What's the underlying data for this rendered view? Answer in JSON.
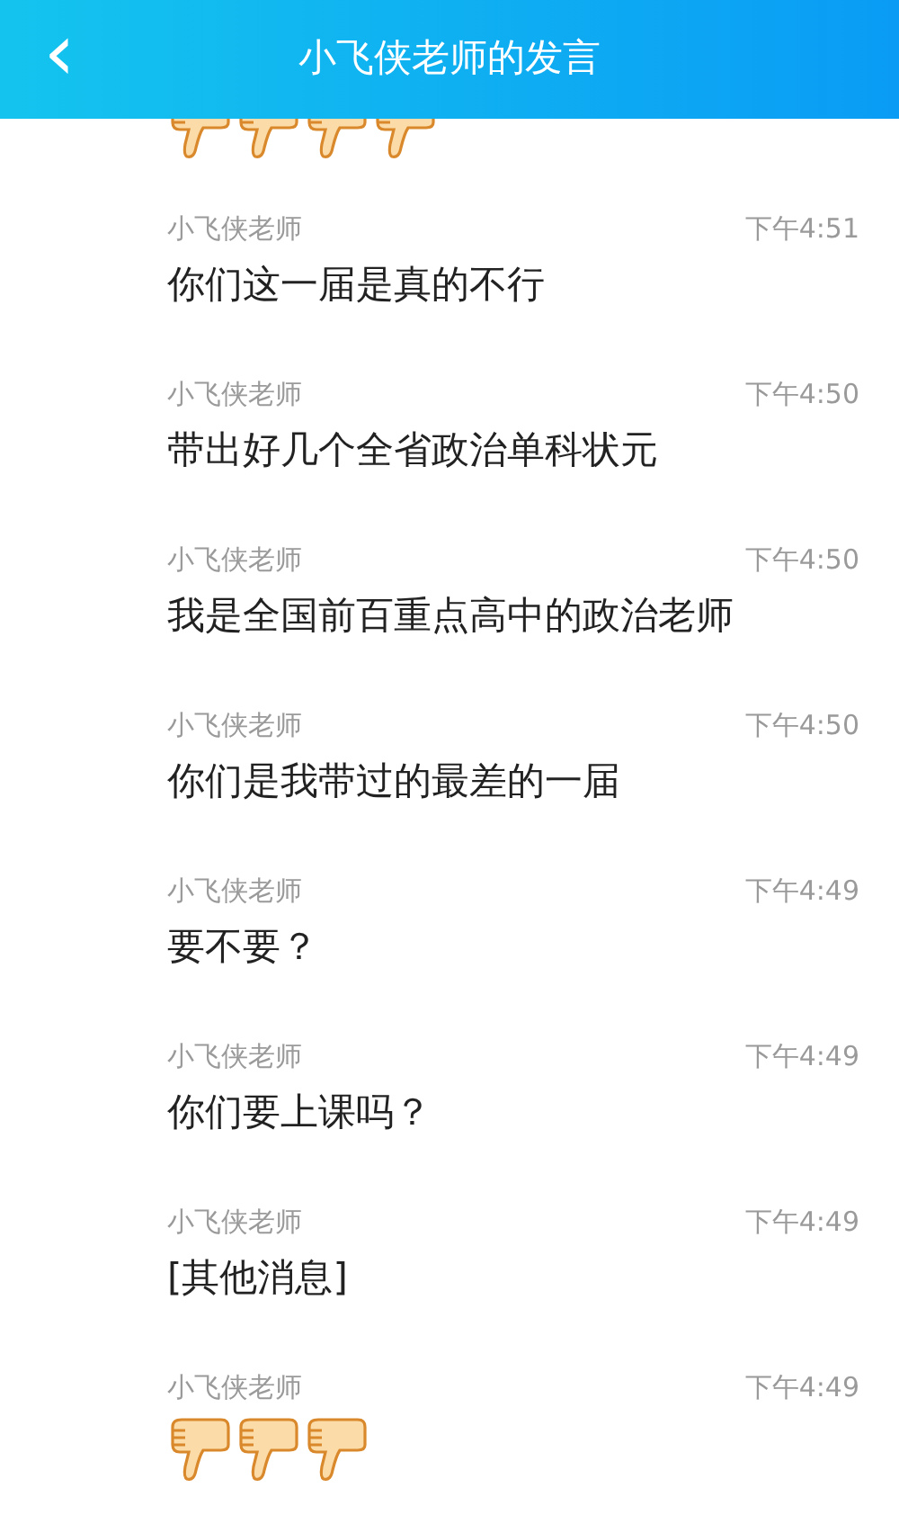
{
  "header": {
    "back_icon": "‹",
    "title": "小飞侠老师的发言"
  },
  "top_partial": {
    "kind": "emoji",
    "emojis": [
      {
        "kind": "thumbs_down"
      },
      {
        "kind": "thumbs_down"
      },
      {
        "kind": "thumbs_down"
      },
      {
        "kind": "thumbs_down"
      }
    ]
  },
  "messages": [
    {
      "sender": "小飞侠老师",
      "time": "下午4:51",
      "kind": "text",
      "text": "你们这一届是真的不行"
    },
    {
      "sender": "小飞侠老师",
      "time": "下午4:50",
      "kind": "text",
      "text": "带出好几个全省政治单科状元"
    },
    {
      "sender": "小飞侠老师",
      "time": "下午4:50",
      "kind": "text",
      "text": "我是全国前百重点高中的政治老师"
    },
    {
      "sender": "小飞侠老师",
      "time": "下午4:50",
      "kind": "text",
      "text": "你们是我带过的最差的一届"
    },
    {
      "sender": "小飞侠老师",
      "time": "下午4:49",
      "kind": "text",
      "text": "要不要？"
    },
    {
      "sender": "小飞侠老师",
      "time": "下午4:49",
      "kind": "text",
      "text": "你们要上课吗？"
    },
    {
      "sender": "小飞侠老师",
      "time": "下午4:49",
      "kind": "text",
      "text": "[其他消息]"
    },
    {
      "sender": "小飞侠老师",
      "time": "下午4:49",
      "kind": "emoji",
      "emojis": [
        {
          "kind": "thumbs_down"
        },
        {
          "kind": "thumbs_down"
        },
        {
          "kind": "thumbs_down"
        }
      ]
    }
  ]
}
